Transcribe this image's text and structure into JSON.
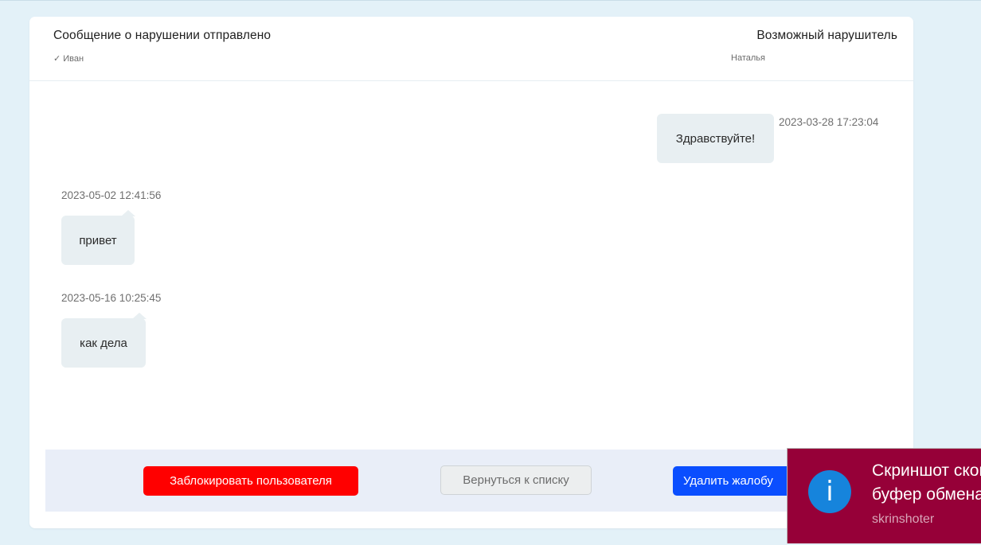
{
  "header": {
    "left_title": "Сообщение о нарушении отправлено",
    "left_sub": "✓ Иван",
    "right_title": "Возможный нарушитель",
    "right_sub": "Наталья"
  },
  "messages": [
    {
      "side": "out",
      "time": "2023-03-28 17:23:04",
      "text": "Здравствуйте!"
    },
    {
      "side": "in",
      "time": "2023-05-02 12:41:56",
      "text": "привет"
    },
    {
      "side": "in",
      "time": "2023-05-16 10:25:45",
      "text": "как дела"
    }
  ],
  "actions": {
    "block_label": "Заблокировать пользователя",
    "back_label": "Вернуться к списку",
    "delete_label": "Удалить жалобу"
  },
  "toast": {
    "icon": "info-icon",
    "icon_glyph": "i",
    "title": "Скриншот скопирован в буфер обмена",
    "source": "skrinshoter"
  },
  "colors": {
    "page_bg": "#e3f1f8",
    "block_button": "#ff0000",
    "delete_button": "#0a4eff",
    "toast_bg": "#960038",
    "toast_icon": "#1684dc"
  }
}
